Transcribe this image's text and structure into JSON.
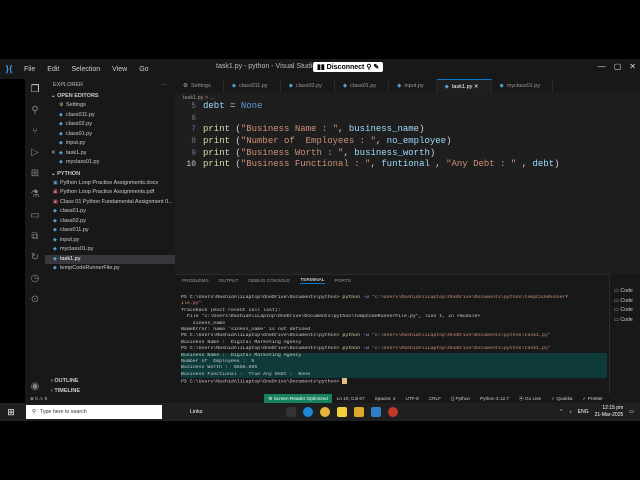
{
  "window": {
    "menu": [
      "File",
      "Edit",
      "Selection",
      "View",
      "Go"
    ],
    "title": "task1.py - python - Visual Studio",
    "disconnect_label": "Disconnect"
  },
  "sidebar": {
    "header": "EXPLORER",
    "open_editors_label": "OPEN EDITORS",
    "open_editors": [
      "Settings",
      "class011.py",
      "class02.py",
      "class01.py",
      "input.py",
      "task1.py",
      "myclass01.py"
    ],
    "folder_label": "PYTHON",
    "files": [
      "Python Loop Practice Assignments.docx",
      "Python Loop Practice Assignments.pdf",
      "Class 01 Python Fundamental Assignment 0...",
      "class01.py",
      "class02.py",
      "class011.py",
      "input.py",
      "myclass01.py",
      "task1.py",
      "tempCodeRunnerFile.py"
    ],
    "outline_label": "OUTLINE",
    "timeline_label": "TIMELINE"
  },
  "tabs": [
    "Settings",
    "class011.py",
    "class02.py",
    "class01.py",
    "input.py",
    "task1.py",
    "myclass01.py"
  ],
  "breadcrumb": "task1.py > ...",
  "editor": {
    "line_numbers": [
      "5",
      "6",
      "7",
      "8",
      "9",
      "10"
    ]
  },
  "panel": {
    "tabs": [
      "PROBLEMS",
      "OUTPUT",
      "DEBUG CONSOLE",
      "TERMINAL",
      "PORTS"
    ],
    "terminal_list": [
      "Code",
      "Code",
      "Code",
      "Code"
    ],
    "prompt": "PS C:\\Users\\RashidAliLaptop\\OneDrive\\Documents\\python> ",
    "cmd_python": "python",
    "cmd_flag": "-u",
    "run_temp_path": "\"c:\\Users\\RashidAliLaptop\\OneDrive\\Documents\\python\\tempCodeRunnerF",
    "run_temp_path_cont": "ile.py\"",
    "run_task_path": "\"c:\\Users\\RashidAliLaptop\\OneDrive\\Documents\\python\\task1.py\"",
    "traceback": [
      "Traceback (most recent call last):",
      "  File \"c:\\Users\\RashidAliLaptop\\OneDrive\\Documents\\python\\tempCodeRunnerFile.py\", line 1, in <module>",
      "    siness_name",
      "NameError: name 'siness_name' is not defined"
    ],
    "output_run1": [
      "Business Name :  Digital Marketing Agency"
    ],
    "output_run2": [
      "Business Name :  Digital Marketing Agency",
      "Number of  Employees :  5",
      "Business Worth :  5555.555",
      "Business Functional :  True Any Debt :  None"
    ]
  },
  "status": {
    "errors": "0 ⚠ 0",
    "screen_reader": "Screen Reader Optimized",
    "position": "Ln 10, Col 67",
    "spaces": "Spaces: 4",
    "encoding": "UTF-8",
    "eol": "CRLF",
    "language": "Python",
    "version": "Python 3.12.7",
    "golive": "Go Live",
    "quokka": "Quokka",
    "prettier": "Prettier"
  },
  "taskbar": {
    "search_placeholder": "Type here to search",
    "links_label": "Links",
    "lang": "ENG",
    "time": "12:15 pm",
    "date": "21-Mar-2025"
  },
  "colors": {
    "accent": "#0078d4",
    "status_green": "#16825d"
  }
}
